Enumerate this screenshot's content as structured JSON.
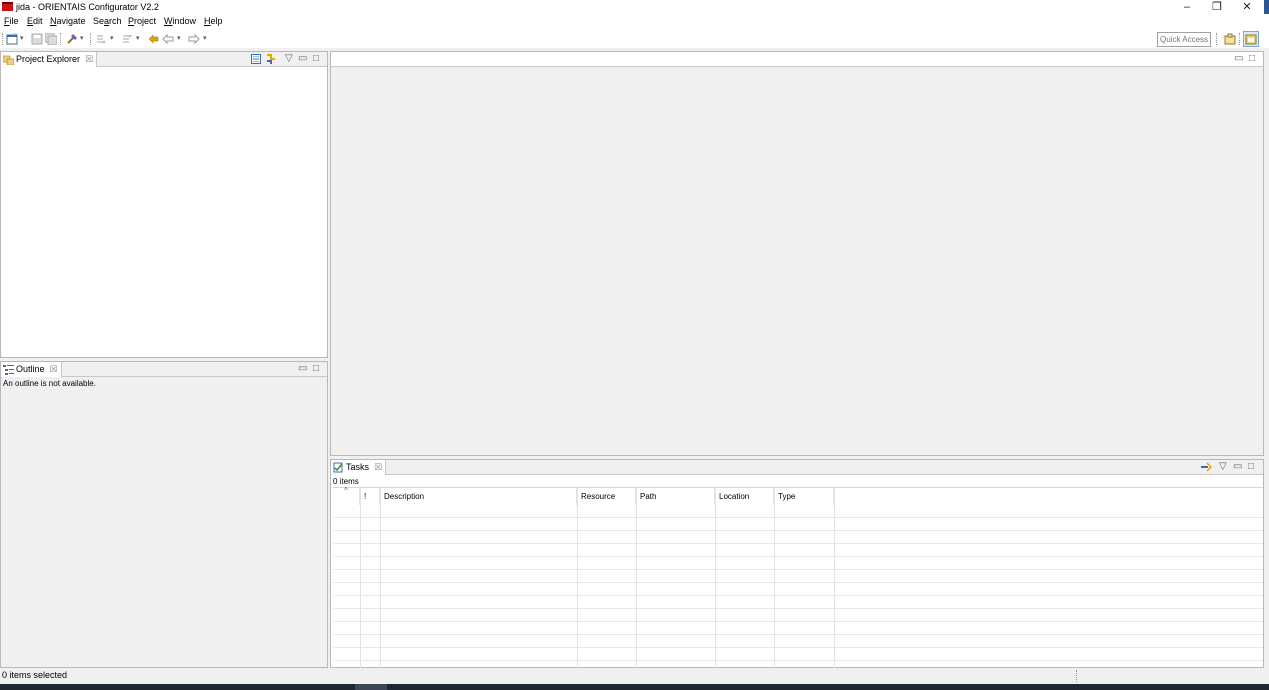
{
  "window": {
    "title": "jida - ORIENTAIS Configurator V2.2",
    "minimize_glyph": "–",
    "restore_glyph": "❐",
    "close_glyph": "✕"
  },
  "menu": {
    "items": [
      {
        "label": "File",
        "mnemonic": "F",
        "rest": "ile"
      },
      {
        "label": "Edit",
        "mnemonic": "E",
        "rest": "dit"
      },
      {
        "label": "Navigate",
        "mnemonic": "N",
        "rest": "avigate"
      },
      {
        "label": "Search",
        "pre": "Se",
        "mnemonic": "a",
        "rest": "rch"
      },
      {
        "label": "Project",
        "mnemonic": "P",
        "rest": "roject"
      },
      {
        "label": "Window",
        "mnemonic": "W",
        "rest": "indow"
      },
      {
        "label": "Help",
        "mnemonic": "H",
        "rest": "elp"
      }
    ]
  },
  "toolbar": {
    "quick_access_placeholder": "Quick Access",
    "icons": [
      "new-icon",
      "save-icon",
      "save-all-icon",
      "build-icon",
      "next-annotation-icon",
      "prev-annotation-icon",
      "last-edit-icon",
      "back-icon",
      "forward-icon",
      "open-perspective-icon",
      "perspective-icon"
    ]
  },
  "project_explorer": {
    "title": "Project Explorer",
    "close_glyph": "☒"
  },
  "outline": {
    "title": "Outline",
    "close_glyph": "☒",
    "message": "An outline is not available."
  },
  "tasks": {
    "title": "Tasks",
    "close_glyph": "☒",
    "count": "0 items",
    "sort_caret": "^",
    "columns": [
      "",
      "!",
      "Description",
      "Resource",
      "Path",
      "Location",
      "Type"
    ]
  },
  "view_controls": {
    "menu_glyph": "▽",
    "minimize_glyph": "▭",
    "maximize_glyph": "□"
  },
  "status": {
    "text": "0 items selected"
  },
  "colors": {
    "accent": "#2b5797",
    "app_icon": "#c81414"
  }
}
